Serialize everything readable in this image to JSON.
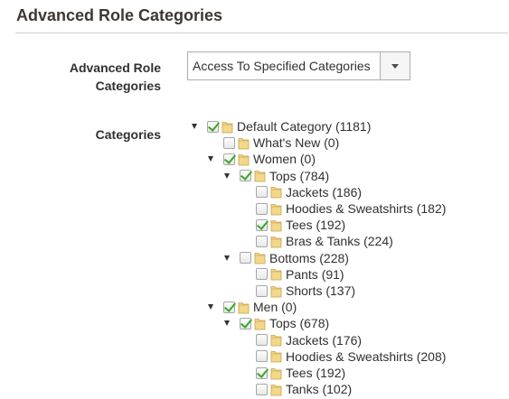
{
  "section": {
    "title": "Advanced Role Categories"
  },
  "form": {
    "role_label": "Advanced Role\nCategories",
    "role_label_line1": "Advanced Role",
    "role_label_line2": "Categories",
    "role_value": "Access To Specified Categories",
    "categories_label": "Categories"
  },
  "tree": [
    {
      "id": "default",
      "label": "Default Category (1181)",
      "level": 0,
      "expandable": true,
      "checked": true
    },
    {
      "id": "whats-new",
      "label": "What's New (0)",
      "level": 1,
      "expandable": false,
      "checked": false
    },
    {
      "id": "women",
      "label": "Women (0)",
      "level": 1,
      "expandable": true,
      "checked": true
    },
    {
      "id": "women-tops",
      "label": "Tops (784)",
      "level": 2,
      "expandable": true,
      "checked": true
    },
    {
      "id": "women-jackets",
      "label": "Jackets (186)",
      "level": 3,
      "expandable": false,
      "checked": false
    },
    {
      "id": "women-hoodies",
      "label": "Hoodies & Sweatshirts (182)",
      "level": 3,
      "expandable": false,
      "checked": false
    },
    {
      "id": "women-tees",
      "label": "Tees (192)",
      "level": 3,
      "expandable": false,
      "checked": true
    },
    {
      "id": "women-bras",
      "label": "Bras & Tanks (224)",
      "level": 3,
      "expandable": false,
      "checked": false
    },
    {
      "id": "women-bottoms",
      "label": "Bottoms (228)",
      "level": 2,
      "expandable": true,
      "checked": false
    },
    {
      "id": "women-pants",
      "label": "Pants (91)",
      "level": 3,
      "expandable": false,
      "checked": false
    },
    {
      "id": "women-shorts",
      "label": "Shorts (137)",
      "level": 3,
      "expandable": false,
      "checked": false
    },
    {
      "id": "men",
      "label": "Men (0)",
      "level": 1,
      "expandable": true,
      "checked": true
    },
    {
      "id": "men-tops",
      "label": "Tops (678)",
      "level": 2,
      "expandable": true,
      "checked": true
    },
    {
      "id": "men-jackets",
      "label": "Jackets (176)",
      "level": 3,
      "expandable": false,
      "checked": false
    },
    {
      "id": "men-hoodies",
      "label": "Hoodies & Sweatshirts (208)",
      "level": 3,
      "expandable": false,
      "checked": false
    },
    {
      "id": "men-tees",
      "label": "Tees (192)",
      "level": 3,
      "expandable": false,
      "checked": true
    },
    {
      "id": "men-tanks",
      "label": "Tanks (102)",
      "level": 3,
      "expandable": false,
      "checked": false
    }
  ],
  "icons": {
    "folder": "folder-icon",
    "checkbox": "checkbox-icon",
    "toggle": "expand-triangle-icon",
    "dropdown": "chevron-down-icon"
  },
  "colors": {
    "check": "#3aa62a",
    "folder_fill": "#f3d78a",
    "folder_stroke": "#c9a24a"
  }
}
